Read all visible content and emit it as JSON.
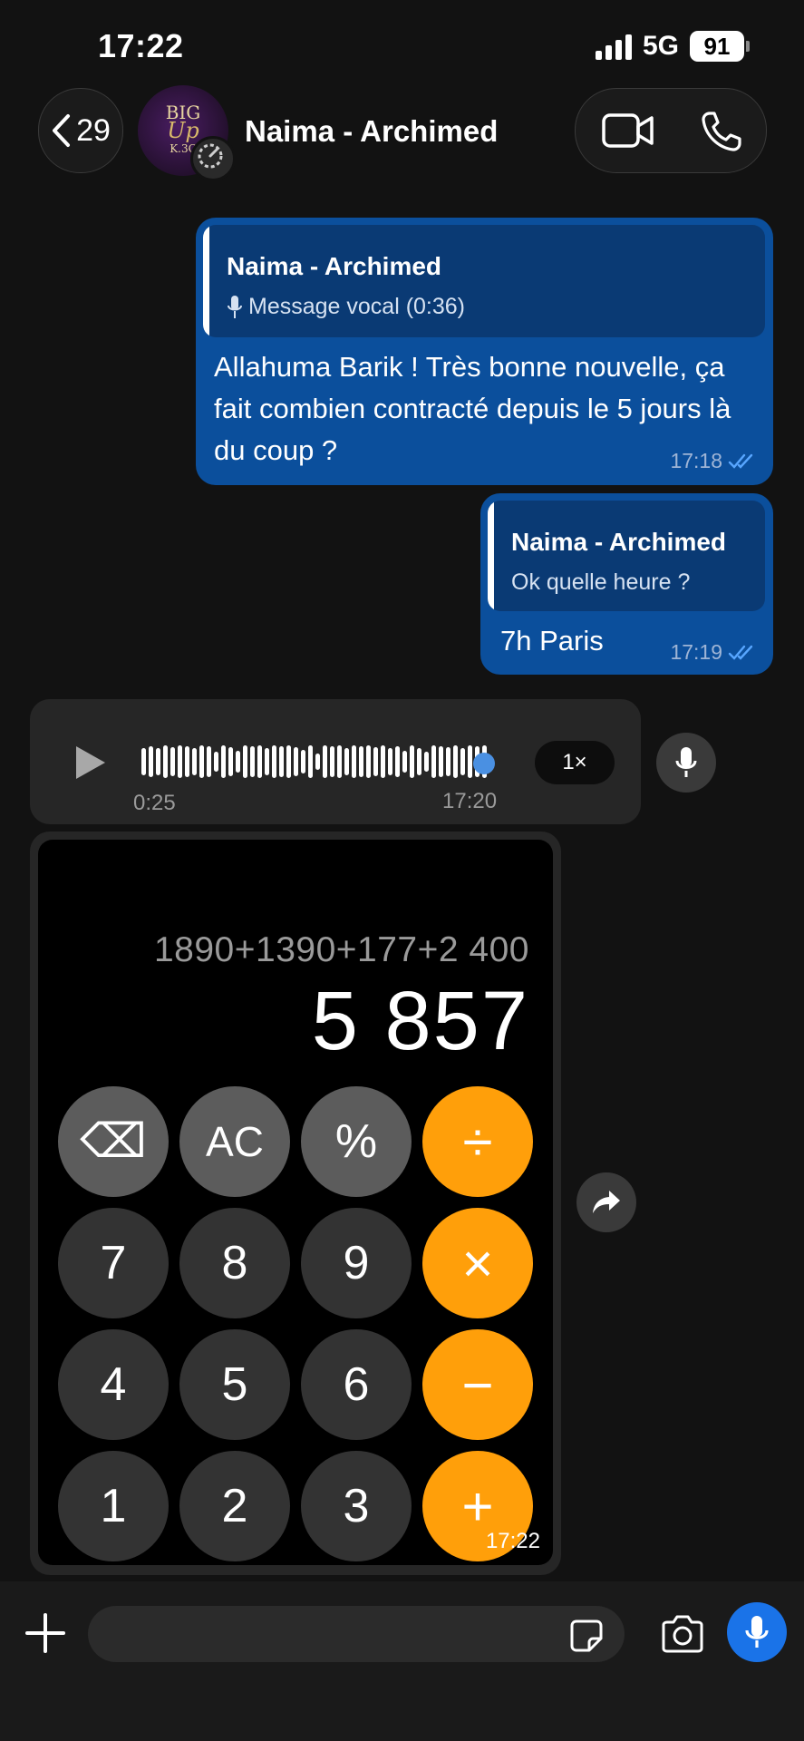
{
  "status_bar": {
    "time": "17:22",
    "network": "5G",
    "battery": "91"
  },
  "header": {
    "back_count": "29",
    "contact_name": "Naima - Archimed",
    "avatar_text": [
      "BIG",
      "Up",
      "K.3C"
    ]
  },
  "messages": [
    {
      "type": "outgoing",
      "quote_name": "Naima - Archimed",
      "quote_text": "Message vocal (0:36)",
      "text": "Allahuma Barik ! Très bonne nouvelle, ça fait combien contracté depuis le 5 jours là du coup ?",
      "time": "17:18"
    },
    {
      "type": "outgoing",
      "quote_name": "Naima - Archimed",
      "quote_text": "Ok quelle heure ?",
      "text": "7h Paris",
      "time": "17:19"
    }
  ],
  "voice_message": {
    "duration": "0:25",
    "time": "17:20",
    "speed": "1×",
    "progress": 0.98
  },
  "calculator_image": {
    "expression": "1890+1390+177+2 400",
    "result": "5 857",
    "time": "17:22",
    "keys": [
      [
        "⌫",
        "AC",
        "%",
        "÷"
      ],
      [
        "7",
        "8",
        "9",
        "×"
      ],
      [
        "4",
        "5",
        "6",
        "−"
      ],
      [
        "1",
        "2",
        "3",
        "+"
      ]
    ]
  },
  "composer": {
    "placeholder": ""
  },
  "colors": {
    "outgoing_bubble": "#0b4f9c",
    "accent_orange": "#ff9f0a",
    "mic_blue": "#1a73e8"
  }
}
